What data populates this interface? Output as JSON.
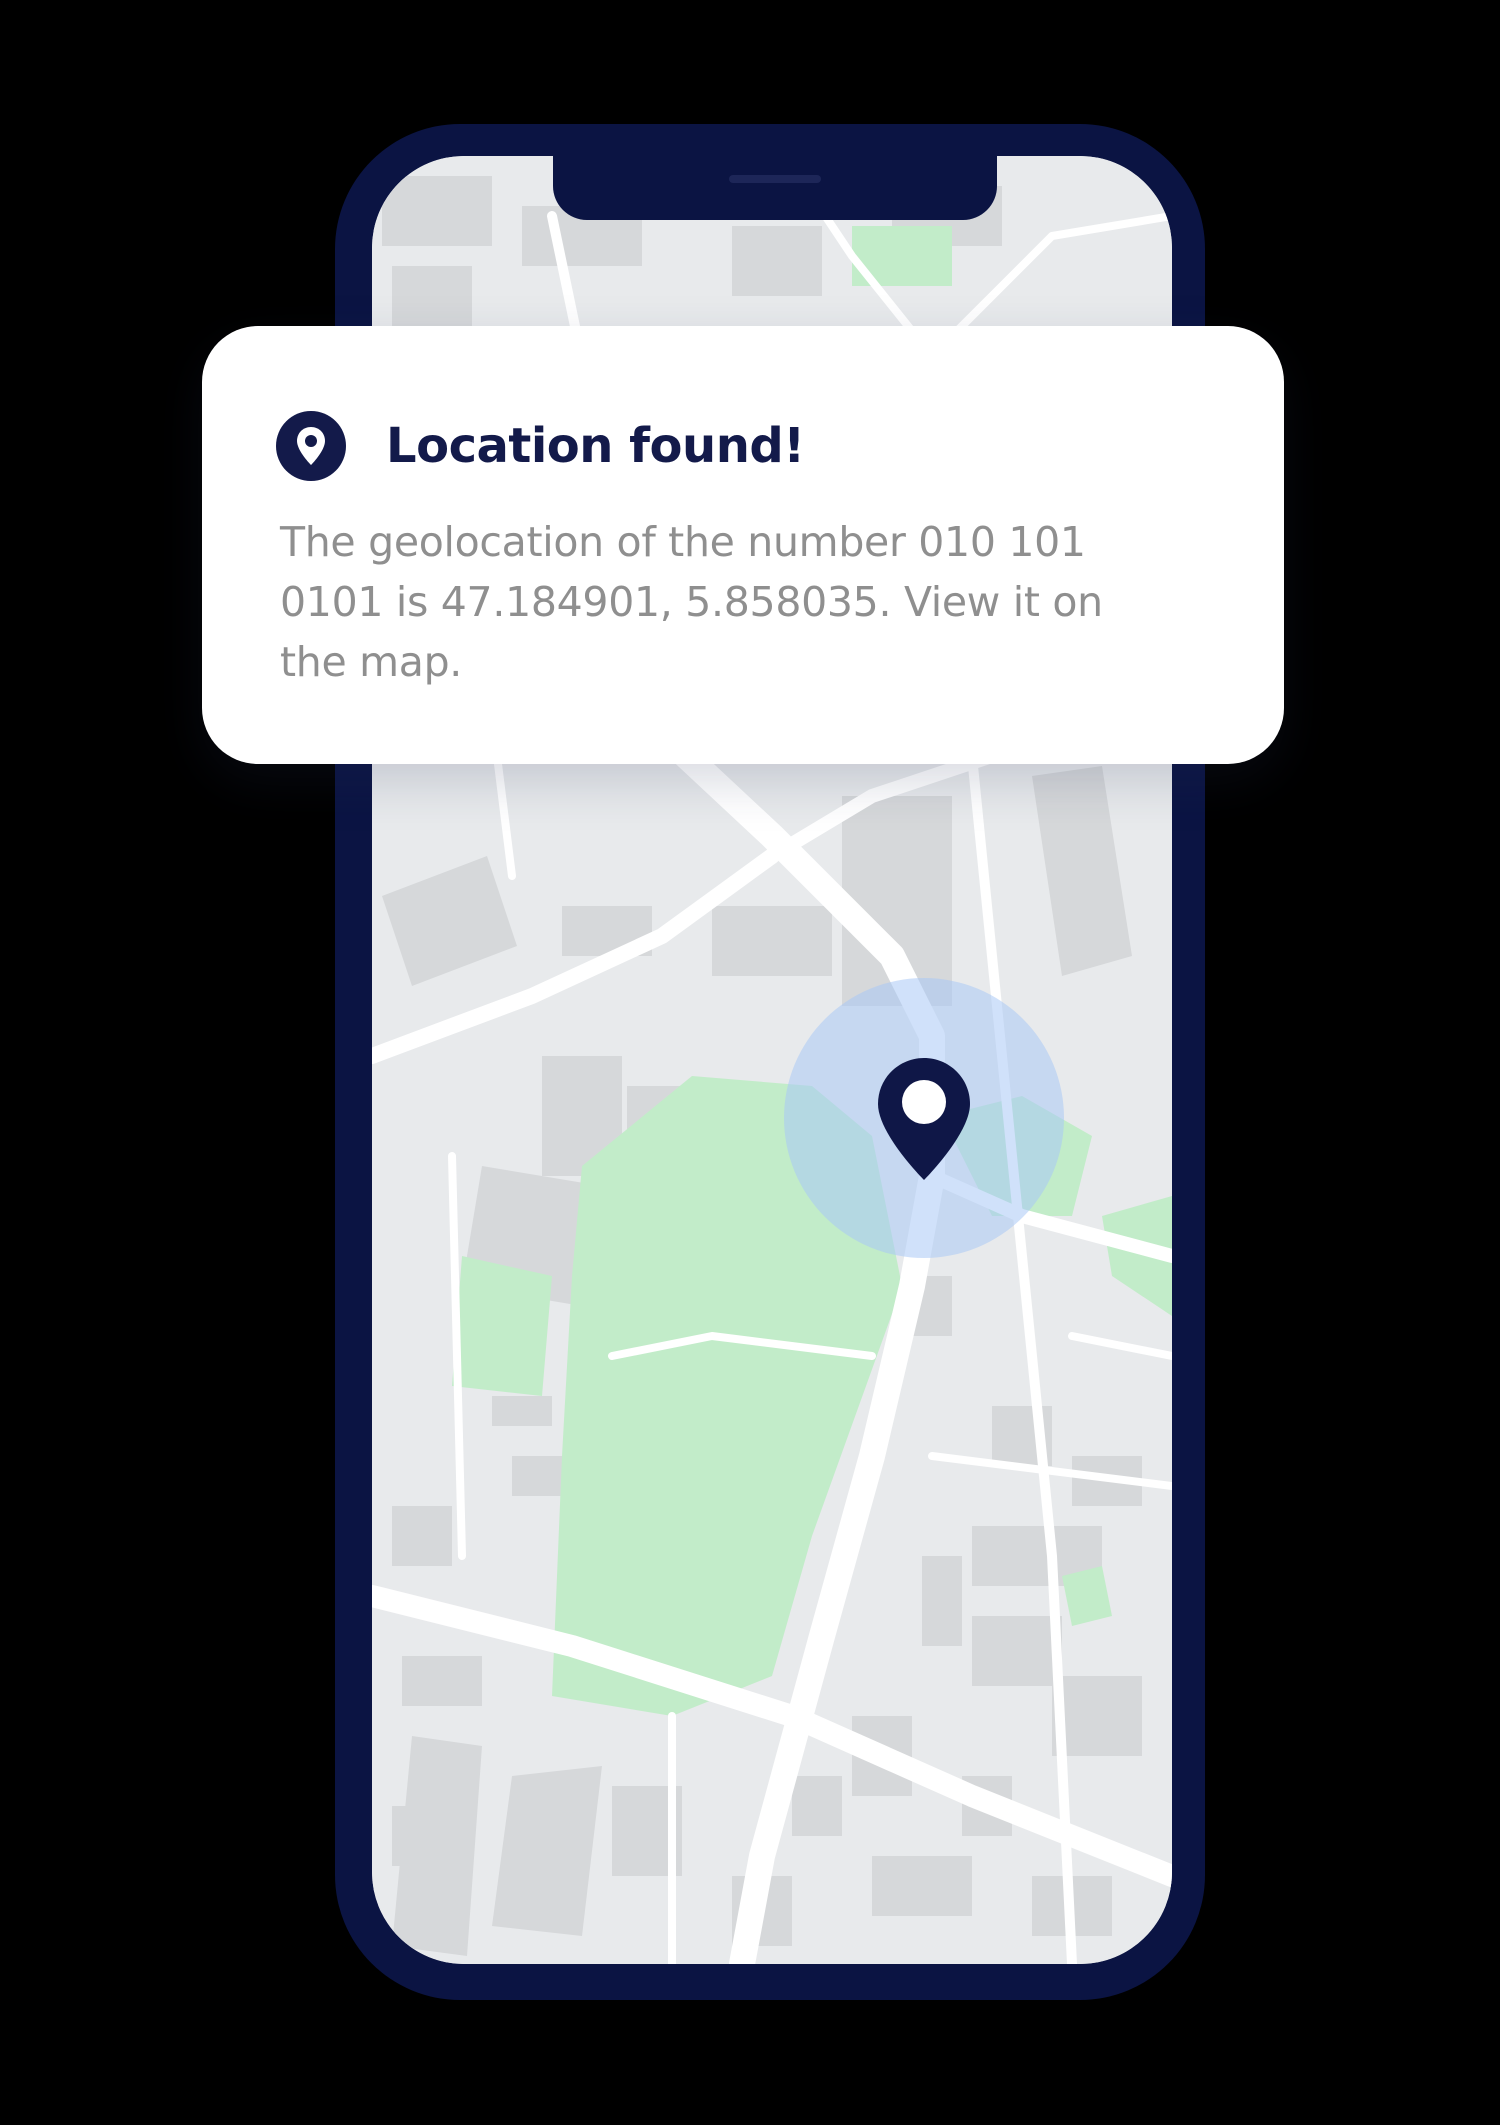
{
  "notification": {
    "icon": "location-pin-icon",
    "title": "Location found!",
    "message": "The geolocation of the number 010 101 0101 is 47.184901, 5.858035. View it on the map."
  },
  "map": {
    "marker_icon": "map-pin-icon",
    "colors": {
      "land": "#e8eaec",
      "roads": "#ffffff",
      "buildings": "#d6d8da",
      "parks": "#c2ecc9",
      "accuracy_circle": "#a9c8f5",
      "pin": "#0f1747"
    }
  },
  "device": {
    "frame_color": "#0b1443"
  }
}
